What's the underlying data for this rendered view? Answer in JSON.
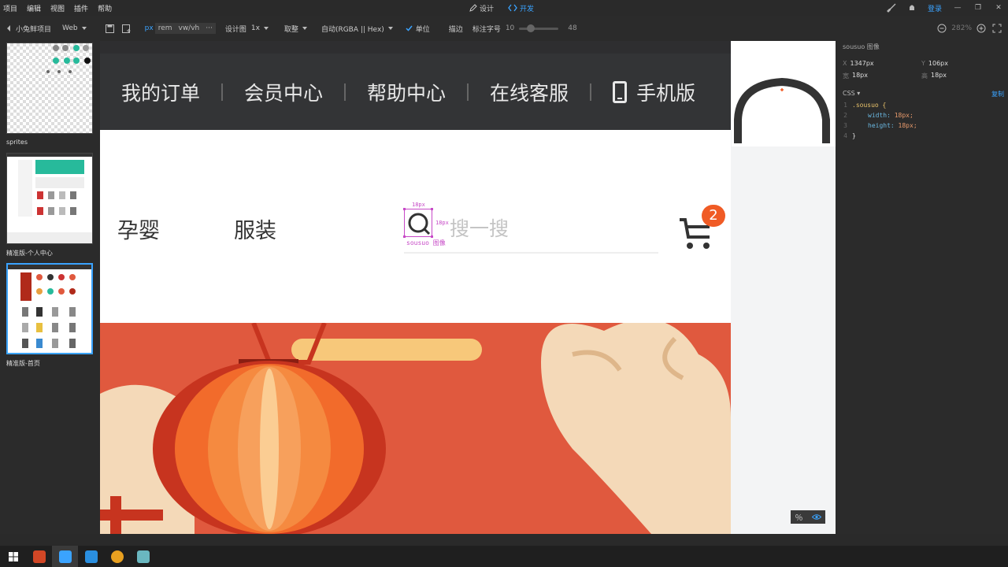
{
  "menubar": {
    "items": [
      "项目",
      "编辑",
      "视图",
      "插件",
      "帮助"
    ],
    "mode_tabs": [
      {
        "label": "设计",
        "icon": "pencil-icon",
        "active": false
      },
      {
        "label": "开发",
        "icon": "code-icon",
        "active": true
      }
    ],
    "login": "登录"
  },
  "toolbar": {
    "project": "小兔鲜项目",
    "platform": "Web",
    "unit_px": "px",
    "unit_rem": "rem",
    "unit_vw": "vw/vh",
    "more": "···",
    "design_label": "设计图",
    "design_scale": "1x",
    "rounding": "取整",
    "color_format": "自动(RGBA || Hex)",
    "unit_label": "单位",
    "stroke_label": "描边",
    "font_size_label": "标注字号",
    "font_size_min": "10",
    "font_size_max": "48",
    "zoom": "282%"
  },
  "artboards": [
    {
      "label": "sprites",
      "selected": false
    },
    {
      "label": "精准版-个人中心",
      "selected": false
    },
    {
      "label": "精准版-首页",
      "selected": true
    }
  ],
  "site": {
    "nav": [
      "我的订单",
      "会员中心",
      "帮助中心",
      "在线客服"
    ],
    "mobile": "手机版",
    "categories": [
      "孕婴",
      "服装"
    ],
    "search_placeholder": "搜一搜",
    "cart_count": "2"
  },
  "measure": {
    "width_label": "18px",
    "height_label": "18px",
    "layer_name": "sousuo 图像"
  },
  "inspector": {
    "title": "sousuo 图像",
    "x_key": "X",
    "x_val": "1347px",
    "y_key": "Y",
    "y_val": "106px",
    "w_key": "宽",
    "w_val": "18px",
    "h_key": "高",
    "h_val": "18px",
    "css_label": "CSS ▾",
    "copy_label": "复制",
    "code": {
      "selector": ".sousuo {",
      "width_prop": "width:",
      "width_val": "18px;",
      "height_prop": "height:",
      "height_val": "18px;",
      "close": "}"
    }
  },
  "colors": {
    "accent": "#3aa3ff",
    "badge": "#f05b25",
    "topbar": "#333436",
    "banner": "#e0593e",
    "measure": "#c74ac7"
  }
}
